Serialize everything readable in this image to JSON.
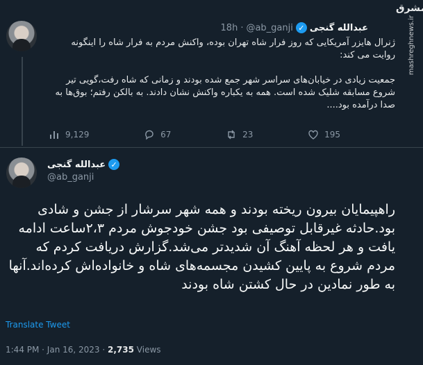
{
  "watermark": {
    "logo": "مشرق",
    "url": "mashreghnews.ir"
  },
  "tweet1": {
    "name": "عبدالله گنجی",
    "handle": "@ab_ganji",
    "separator": "·",
    "time": "18h",
    "text": "ژنرال هایزر آمریکایی که روز فرار شاه تهران بوده، واکنش مردم به فرار شاه را اینگونه روایت می کند:\n\nجمعیت زیادی در خیابان‌های سراسر شهر جمع شده بودند و زمانی که شاه رفت،گویی تیر شروع مسابقه شلیک شده است. همه به یکباره واکنش نشان دادند. به بالکن رفتم؛ بوق‌ها به صدا درآمده بود....",
    "stats": {
      "views": "9,129",
      "replies": "67",
      "retweets": "23",
      "likes": "195"
    }
  },
  "tweet2": {
    "name": "عبدالله گنجی",
    "handle": "@ab_ganji",
    "text": "راهپیمایان بیرون ریخته بودند و همه شهر سرشار از جشن و شادی بود.حادثه غیرقابل توصیفی بود جشن خودجوش مردم ۲،۳ساعت ادامه یافت و هر لحظه آهنگ آن شدیدتر می‌شد.گزارش دریافت کردم که مردم شروع به پایین کشیدن مجسمه‌های شاه و خانواده‌اش کرده‌اند.آنها به طور نمادین در حال کشتن شاه بودند",
    "translate": "Translate Tweet",
    "time": "1:44 PM · Jan 16, 2023 · ",
    "views": "2,735",
    "views_label": " Views"
  }
}
